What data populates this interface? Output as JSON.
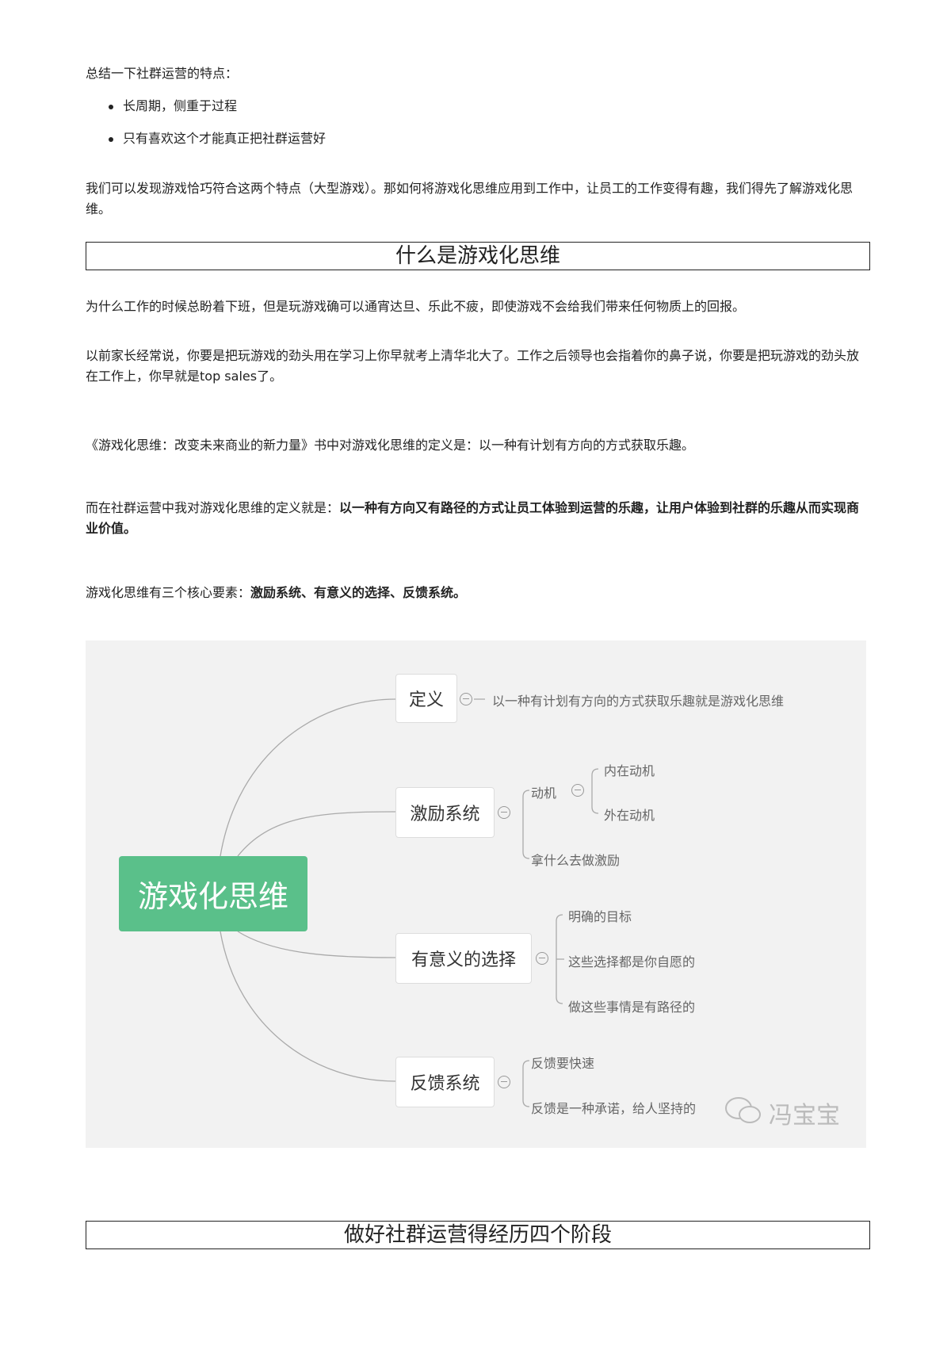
{
  "intro": {
    "summary": "总结一下社群运营的特点：",
    "bullets": [
      "长周期，侧重于过程",
      "只有喜欢这个才能真正把社群运营好"
    ],
    "para": "我们可以发现游戏恰巧符合这两个特点（大型游戏）。那如何将游戏化思维应用到工作中，让员工的工作变得有趣，我们得先了解游戏化思维。"
  },
  "section1": {
    "heading": "什么是游戏化思维",
    "p1": "为什么工作的时候总盼着下班，但是玩游戏确可以通宵达旦、乐此不疲，即使游戏不会给我们带来任何物质上的回报。",
    "p2": "以前家长经常说，你要是把玩游戏的劲头用在学习上你早就考上清华北大了。工作之后领导也会指着你的鼻子说，你要是把玩游戏的劲头放在工作上，你早就是top sales了。",
    "p3": "《游戏化思维：改变未来商业的新力量》书中对游戏化思维的定义是：以一种有计划有方向的方式获取乐趣。",
    "p4_plain": "而在社群运营中我对游戏化思维的定义就是：",
    "p4_bold": "以一种有方向又有路径的方式让员工体验到运营的乐趣，让用户体验到社群的乐趣从而实现商业价值。",
    "p5_plain": "游戏化思维有三个核心要素：",
    "p5_bold": "激励系统、有意义的选择、反馈系统。"
  },
  "mindmap": {
    "center": "游戏化思维",
    "accent": "#5ac08a",
    "definition": {
      "label": "定义",
      "leaf": "以一种有计划有方向的方式获取乐趣就是游戏化思维"
    },
    "incentive": {
      "label": "激励系统",
      "motive": "动机",
      "inner": "内在动机",
      "outer": "外在动机",
      "what": "拿什么去做激励"
    },
    "choice": {
      "label": "有意义的选择",
      "leaves": [
        "明确的目标",
        "这些选择都是你自愿的",
        "做这些事情是有路径的"
      ]
    },
    "feedback": {
      "label": "反馈系统",
      "leaves": [
        "反馈要快速",
        "反馈是一种承诺，给人坚持的"
      ]
    },
    "watermark": "冯宝宝"
  },
  "section2": {
    "heading": "做好社群运营得经历四个阶段"
  }
}
